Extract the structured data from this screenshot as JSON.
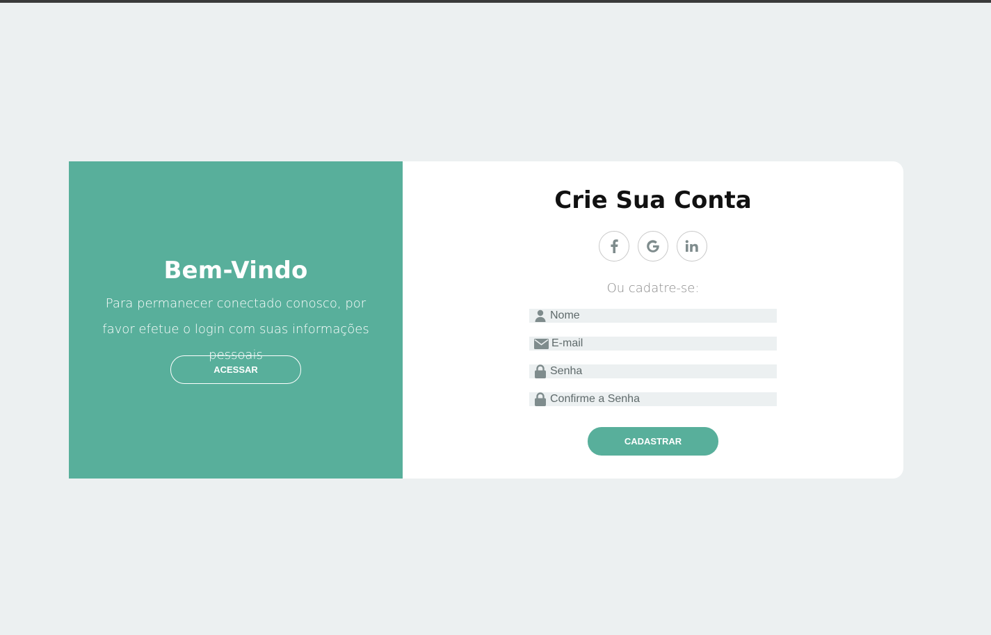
{
  "welcome": {
    "title": "Bem-Vindo",
    "text": "Para permanecer conectado conosco, por favor efetue o login com suas informações pessoais",
    "button_label": "ACESSAR"
  },
  "form": {
    "title": "Crie Sua Conta",
    "social": [
      {
        "icon": "facebook-icon"
      },
      {
        "icon": "google-icon"
      },
      {
        "icon": "linkedin-icon"
      }
    ],
    "subtitle": "Ou cadatre-se:",
    "fields": {
      "name": {
        "placeholder": "Nome",
        "value": "",
        "icon": "user-icon"
      },
      "email": {
        "placeholder": "E-mail",
        "value": "",
        "icon": "envelope-icon"
      },
      "password": {
        "placeholder": "Senha",
        "value": "",
        "icon": "lock-icon"
      },
      "confirm": {
        "placeholder": "Confirme a Senha",
        "value": "",
        "icon": "lock-icon"
      }
    },
    "button_label": "CADASTRAR"
  },
  "colors": {
    "accent": "#58af9b",
    "background": "#ecf0f1",
    "icon": "#7f8c8d"
  }
}
